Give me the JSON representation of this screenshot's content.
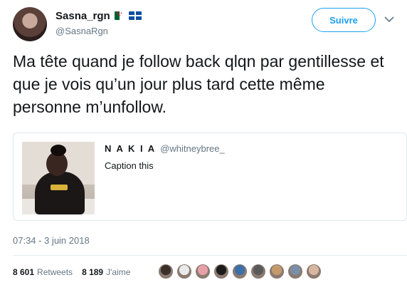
{
  "author": {
    "display_name": "Sasna_rgn",
    "handle": "@SasnaRgn",
    "flag_icons": [
      "algeria-flag-icon",
      "brittany-flag-icon"
    ]
  },
  "follow_button": {
    "label": "Suivre"
  },
  "tweet": {
    "text": "Ma tête quand je follow back qlqn par gentillesse et que je vois qu’un jour plus tard cette même personne m’unfollow."
  },
  "quoted_tweet": {
    "name": "N A K I A",
    "handle": "@whitneybree_",
    "text": "Caption this"
  },
  "timestamp": "07:34 - 3 juin 2018",
  "stats": {
    "retweets_count": "8 601",
    "retweets_label": "Retweets",
    "likes_count": "8 189",
    "likes_label": "J'aime"
  },
  "likers": [
    {
      "color": "#3b2f2a"
    },
    {
      "color": "#e9e9e9"
    },
    {
      "color": "#e7a0a8"
    },
    {
      "color": "#1b1b1b"
    },
    {
      "color": "#3c6fa8"
    },
    {
      "color": "#5a5a5a"
    },
    {
      "color": "#c49a6c"
    },
    {
      "color": "#7a8fa8"
    },
    {
      "color": "#d7b7a0"
    }
  ],
  "colors": {
    "accent": "#1da1f2",
    "text": "#14171a",
    "muted": "#657786"
  }
}
